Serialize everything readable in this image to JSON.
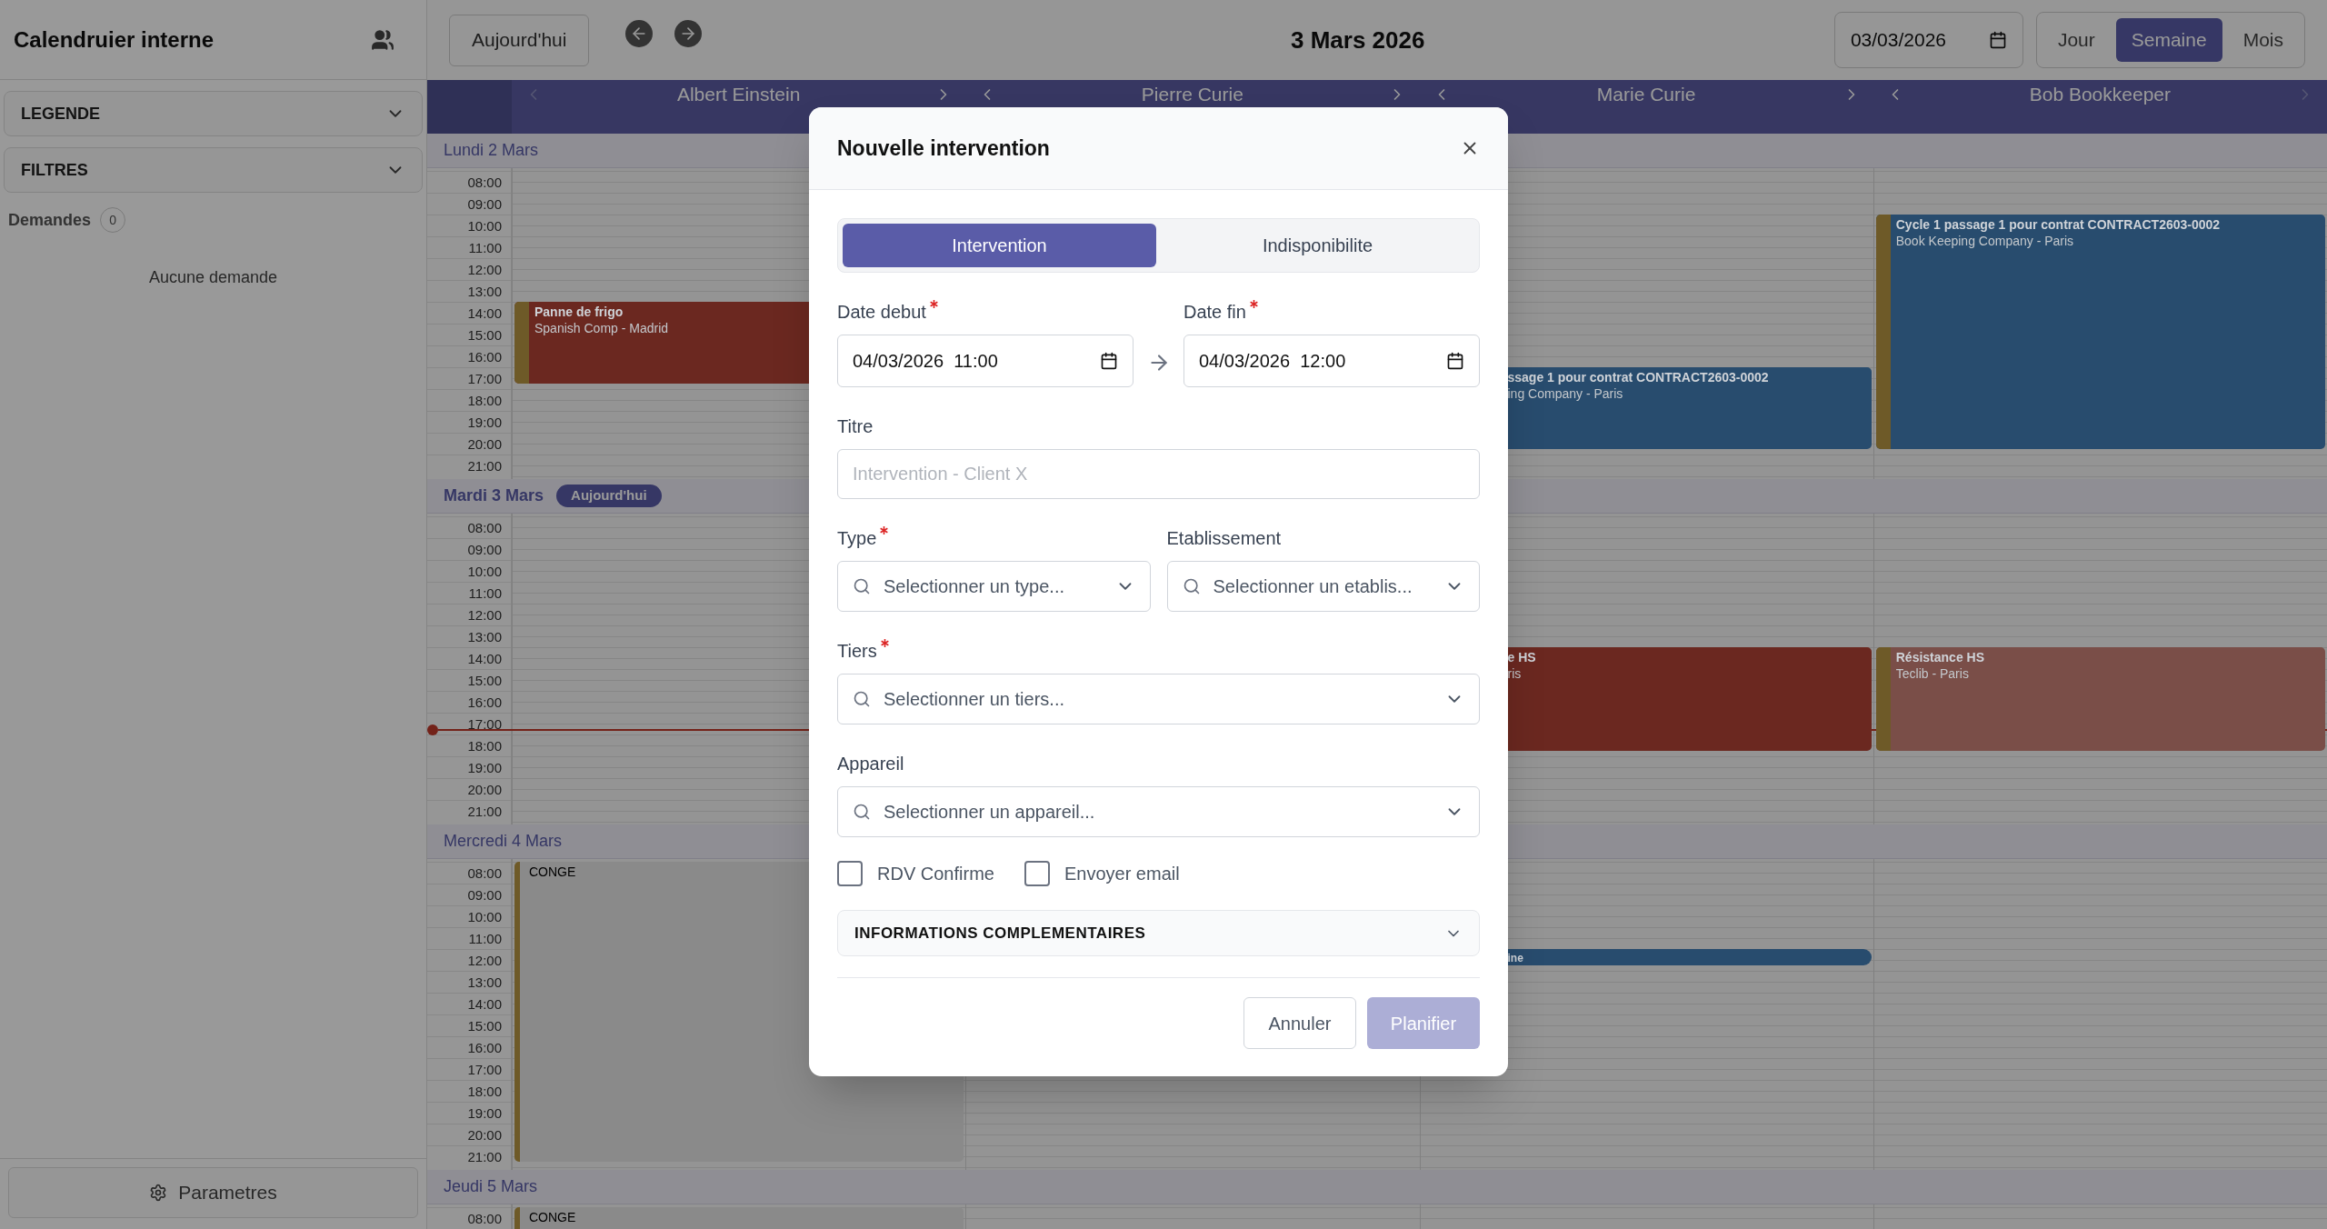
{
  "sidebar": {
    "title": "Calendruier interne",
    "accordions": [
      {
        "label": "LEGENDE",
        "expanded": false
      },
      {
        "label": "FILTRES",
        "expanded": false
      }
    ],
    "requests": {
      "label": "Demandes",
      "count": "0",
      "empty_text": "Aucune demande"
    },
    "settings_button": "Parametres"
  },
  "toolbar": {
    "today_button": "Aujourd'hui",
    "title": "3 Mars 2026",
    "date_value": "03/03/2026",
    "views": [
      {
        "label": "Jour",
        "selected": false
      },
      {
        "label": "Semaine",
        "selected": true
      },
      {
        "label": "Mois",
        "selected": false
      }
    ]
  },
  "resources": [
    {
      "name": "Albert Einstein",
      "prev_enabled": false,
      "next_enabled": true
    },
    {
      "name": "Pierre Curie",
      "prev_enabled": true,
      "next_enabled": true
    },
    {
      "name": "Marie Curie",
      "prev_enabled": true,
      "next_enabled": true
    },
    {
      "name": "Bob Bookkeeper",
      "prev_enabled": true,
      "next_enabled": false
    }
  ],
  "days": [
    {
      "label": "Lundi 2 Mars",
      "hours": [
        "08:00",
        "09:00",
        "10:00",
        "11:00",
        "12:00",
        "13:00",
        "14:00",
        "15:00",
        "16:00",
        "17:00",
        "18:00",
        "19:00",
        "20:00",
        "21:00"
      ],
      "events": [
        {
          "kind": "job",
          "title": "Panne de frigo",
          "subtitle": "Spanish Comp - Madrid",
          "color": "#6b2820"
        },
        {
          "kind": "job",
          "title": "ssage 1 pour contrat CONTRACT2603-0002",
          "subtitle": "ing Company - Paris",
          "color": "#284c6e"
        },
        {
          "kind": "job",
          "title": "Cycle 1 passage 1 pour contrat CONTRACT2603-0002",
          "subtitle": "Book Keeping Company - Paris",
          "color": "#284c6e"
        }
      ]
    },
    {
      "label": "Mardi 3 Mars",
      "badge": "Aujourd'hui",
      "hours": [
        "08:00",
        "09:00",
        "10:00",
        "11:00",
        "12:00",
        "13:00",
        "14:00",
        "15:00",
        "16:00",
        "17:00",
        "18:00",
        "19:00",
        "20:00",
        "21:00"
      ],
      "events": [
        {
          "kind": "job",
          "title": "e HS",
          "subtitle": "ris",
          "color": "#6b2820"
        },
        {
          "kind": "job",
          "title": "Résistance HS",
          "subtitle": "Teclib - Paris",
          "color": "#7a4e48"
        }
      ]
    },
    {
      "label": "Mercredi 4 Mars",
      "hours": [
        "08:00",
        "09:00",
        "10:00",
        "11:00",
        "12:00",
        "13:00",
        "14:00",
        "15:00",
        "16:00",
        "17:00",
        "18:00",
        "19:00",
        "20:00",
        "21:00"
      ],
      "events": [
        {
          "kind": "leave",
          "title": "CONGE",
          "color": "#8a8a8a"
        },
        {
          "kind": "job",
          "title": "ine",
          "color": "#284c6e"
        }
      ]
    },
    {
      "label": "Jeudi 5 Mars",
      "hours": [
        "08:00"
      ],
      "events": [
        {
          "kind": "leave",
          "title": "CONGE",
          "color": "#8a8a8a"
        }
      ]
    }
  ],
  "modal": {
    "title": "Nouvelle intervention",
    "tabs": [
      {
        "label": "Intervention",
        "selected": true
      },
      {
        "label": "Indisponibilite",
        "selected": false
      }
    ],
    "date_start": {
      "label": "Date debut",
      "required": true,
      "value": "04/03/2026  11:00"
    },
    "date_end": {
      "label": "Date fin",
      "required": true,
      "value": "04/03/2026  12:00"
    },
    "title_field": {
      "label": "Titre",
      "placeholder": "Intervention - Client X"
    },
    "type": {
      "label": "Type",
      "required": true,
      "placeholder": "Selectionner un type..."
    },
    "establishment": {
      "label": "Etablissement",
      "required": false,
      "placeholder": "Selectionner un etablis..."
    },
    "third_party": {
      "label": "Tiers",
      "required": true,
      "placeholder": "Selectionner un tiers..."
    },
    "device": {
      "label": "Appareil",
      "required": false,
      "placeholder": "Selectionner un appareil..."
    },
    "checkboxes": [
      {
        "label": "RDV Confirme",
        "checked": false
      },
      {
        "label": "Envoyer email",
        "checked": false
      }
    ],
    "accordion": {
      "label": "INFORMATIONS COMPLEMENTAIRES",
      "expanded": false
    },
    "cancel_button": "Annuler",
    "submit_button": {
      "label": "Planifier",
      "disabled": true
    }
  }
}
